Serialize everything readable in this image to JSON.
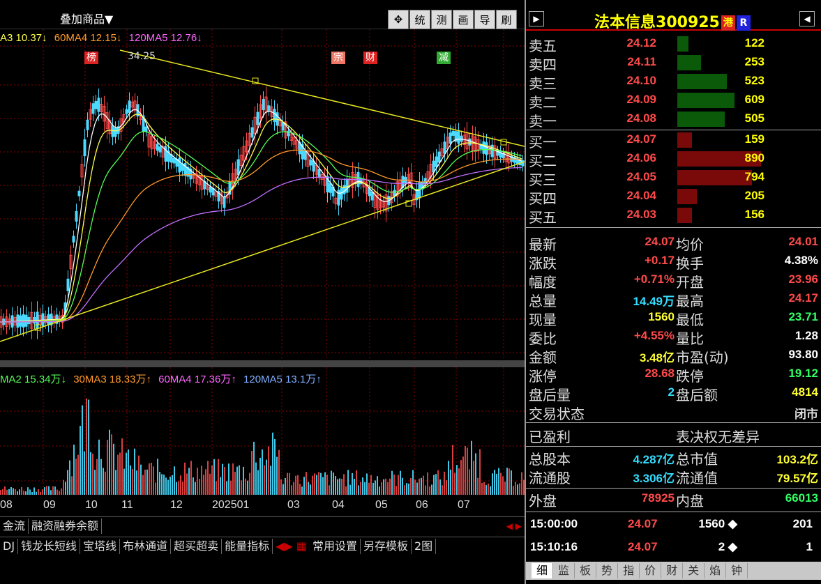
{
  "window": {
    "overlay_menu": "叠加商品▼"
  },
  "toolbar": {
    "buttons": [
      {
        "icon": "move-cross-icon",
        "label": "✥"
      },
      {
        "label": "统"
      },
      {
        "label": "测"
      },
      {
        "label": "画"
      },
      {
        "label": "导"
      },
      {
        "label": "刷"
      }
    ]
  },
  "price_ma": [
    {
      "text": "A3 10.37↓",
      "color": "#ffff4a"
    },
    {
      "text": "60MA4 12.15↓",
      "color": "#ff9a2a"
    },
    {
      "text": "120MA5 12.76↓",
      "color": "#ff66ff"
    }
  ],
  "markers": [
    "榜",
    "宗",
    "财",
    "减"
  ],
  "peak_label": "34.25",
  "volume_ma": [
    {
      "text": "MA2 15.34万↓",
      "color": "#55ff55"
    },
    {
      "text": "30MA3 18.33万↑",
      "color": "#ff9a2a"
    },
    {
      "text": "60MA4 17.36万↑",
      "color": "#ff66ff"
    },
    {
      "text": "120MA5 13.1万↑",
      "color": "#7fb0ff"
    }
  ],
  "x_axis": [
    "08",
    "09",
    "10",
    "11",
    "12",
    "202501",
    "03",
    "04",
    "05",
    "06",
    "07"
  ],
  "tabs_row1": [
    "金流",
    "融资融券余额"
  ],
  "tabs_row2": [
    "DJ",
    "钱龙长短线",
    "宝塔线",
    "布林通道",
    "超买超卖",
    "能量指标",
    "常用设置",
    "另存模板",
    "2图"
  ],
  "quote": {
    "name": "法本信息",
    "code": "300925",
    "badge1": "港",
    "badge2": "R",
    "sell": [
      {
        "label": "卖五",
        "price": "24.12",
        "vol": "122",
        "volume": 122
      },
      {
        "label": "卖四",
        "price": "24.11",
        "vol": "253",
        "volume": 253
      },
      {
        "label": "卖三",
        "price": "24.10",
        "vol": "523",
        "volume": 523
      },
      {
        "label": "卖二",
        "price": "24.09",
        "vol": "609",
        "volume": 609
      },
      {
        "label": "卖一",
        "price": "24.08",
        "vol": "505",
        "volume": 505
      }
    ],
    "buy": [
      {
        "label": "买一",
        "price": "24.07",
        "vol": "159",
        "volume": 159
      },
      {
        "label": "买二",
        "price": "24.06",
        "vol": "890",
        "volume": 890
      },
      {
        "label": "买三",
        "price": "24.05",
        "vol": "794",
        "volume": 794
      },
      {
        "label": "买四",
        "price": "24.04",
        "vol": "205",
        "volume": 205
      },
      {
        "label": "买五",
        "price": "24.03",
        "vol": "156",
        "volume": 156
      }
    ],
    "stats": [
      {
        "l1": "最新",
        "v1": "24.07",
        "c1": "#ff4a4a",
        "l2": "均价",
        "v2": "24.01",
        "c2": "#ff4a4a"
      },
      {
        "l1": "涨跌",
        "v1": "+0.17",
        "c1": "#ff4a4a",
        "l2": "换手",
        "v2": "4.38%",
        "c2": "#ffffff"
      },
      {
        "l1": "幅度",
        "v1": "+0.71%",
        "c1": "#ff4a4a",
        "l2": "开盘",
        "v2": "23.96",
        "c2": "#ff4a4a"
      },
      {
        "l1": "总量",
        "v1": "14.49万",
        "c1": "#33ddff",
        "l2": "最高",
        "v2": "24.17",
        "c2": "#ff4a4a"
      },
      {
        "l1": "现量",
        "v1": "1560",
        "c1": "#ffff33",
        "l2": "最低",
        "v2": "23.71",
        "c2": "#33ff66"
      },
      {
        "l1": "委比",
        "v1": "+4.55%",
        "c1": "#ff4a4a",
        "l2": "量比",
        "v2": "1.28",
        "c2": "#ffffff"
      },
      {
        "l1": "金额",
        "v1": "3.48亿",
        "c1": "#ffff33",
        "l2": "市盈(动)",
        "v2": "93.80",
        "c2": "#ffffff"
      },
      {
        "l1": "涨停",
        "v1": "28.68",
        "c1": "#ff4a4a",
        "l2": "跌停",
        "v2": "19.12",
        "c2": "#33ff66"
      },
      {
        "l1": "盘后量",
        "v1": "2",
        "c1": "#33ddff",
        "l2": "盘后额",
        "v2": "4814",
        "c2": "#ffff33"
      },
      {
        "l1": "交易状态",
        "v1": "",
        "c1": "#ffffff",
        "l2": "",
        "v2": "闭市",
        "c2": "#dddddd"
      }
    ],
    "profit": "已盈利",
    "vote": "表决权无差异",
    "shares": [
      {
        "l1": "总股本",
        "v1": "4.287亿",
        "c1": "#33ddff",
        "l2": "总市值",
        "v2": "103.2亿",
        "c2": "#ffff33"
      },
      {
        "l1": "流通股",
        "v1": "3.306亿",
        "c1": "#33ddff",
        "l2": "流通值",
        "v2": "79.57亿",
        "c2": "#ffff33"
      }
    ],
    "outer": {
      "l1": "外盘",
      "v1": "78925",
      "l2": "内盘",
      "v2": "66013"
    },
    "trades": [
      {
        "time": "15:00:00",
        "price": "24.07",
        "vol": "1560 ◆",
        "cnt": "201"
      },
      {
        "time": "15:10:16",
        "price": "24.07",
        "vol": "2 ◆",
        "cnt": "1"
      }
    ],
    "bottom_tabs": [
      "细",
      "监",
      "板",
      "势",
      "指",
      "价",
      "财",
      "关",
      "焰",
      "钟"
    ]
  }
}
